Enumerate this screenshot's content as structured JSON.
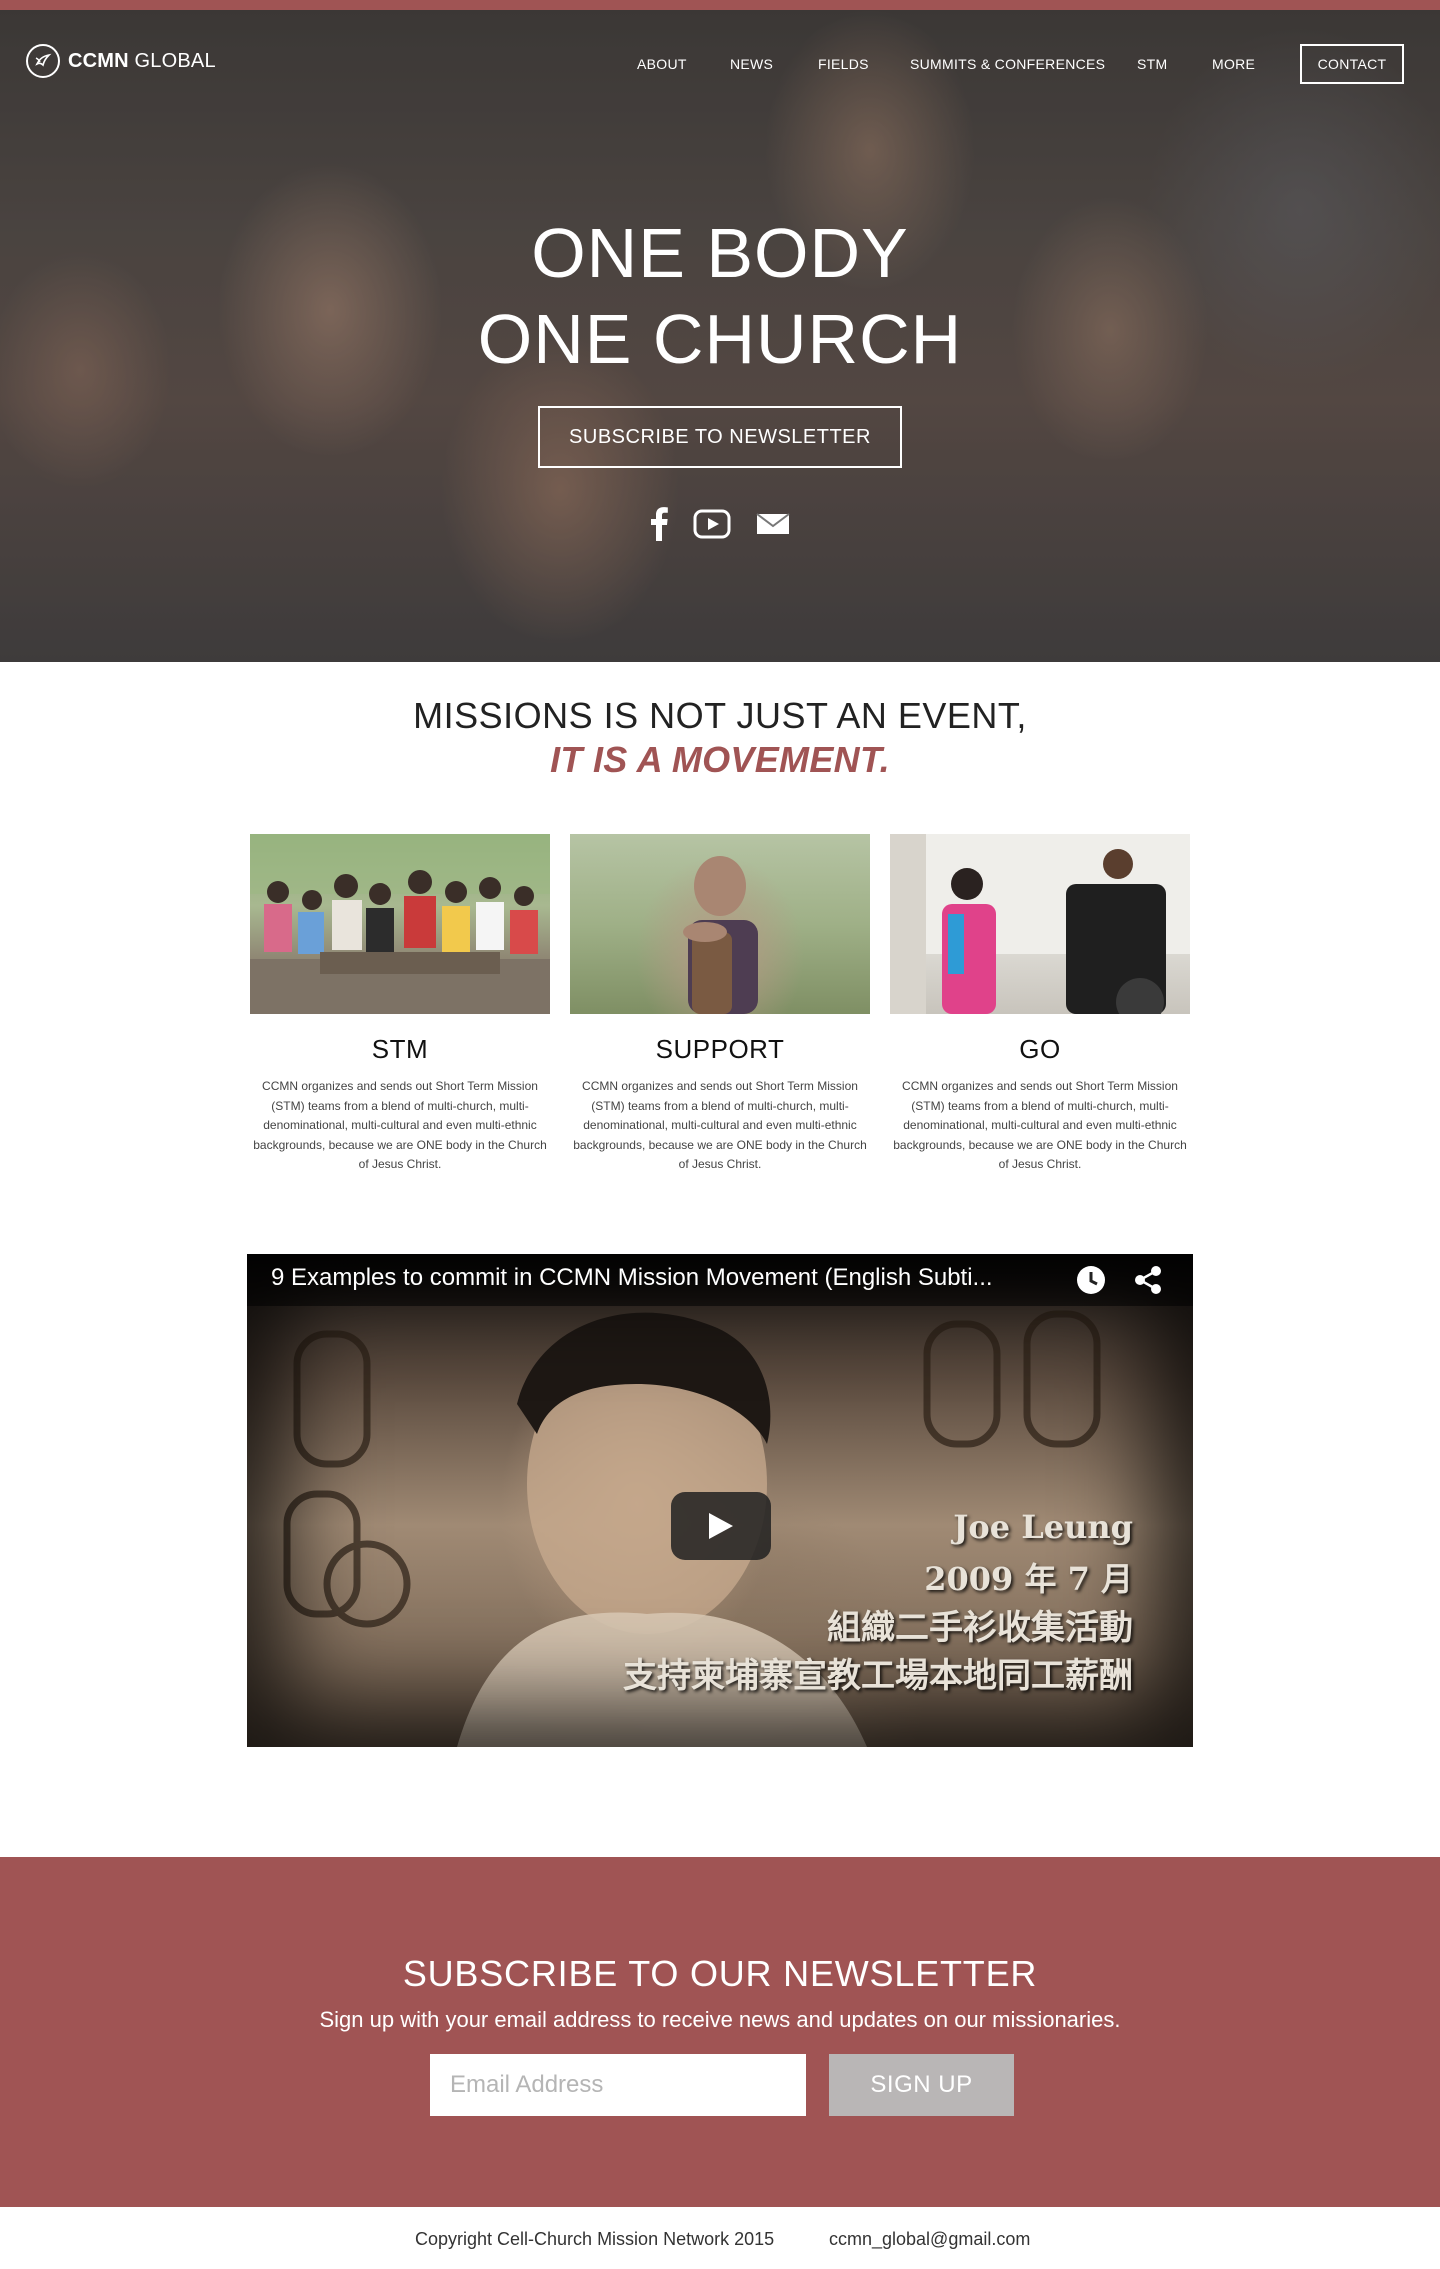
{
  "brand": {
    "logo_bold": "CCMN",
    "logo_light": " GLOBAL"
  },
  "nav": {
    "items": [
      {
        "label": "ABOUT"
      },
      {
        "label": "NEWS"
      },
      {
        "label": "FIELDS"
      },
      {
        "label": "SUMMITS & CONFERENCES"
      },
      {
        "label": "STM"
      },
      {
        "label": "MORE"
      }
    ],
    "contact_label": "CONTACT"
  },
  "hero": {
    "title_line1": "ONE BODY",
    "title_line2": "ONE CHURCH",
    "subscribe_label": "SUBSCRIBE TO NEWSLETTER",
    "social_icons": [
      "facebook-icon",
      "youtube-icon",
      "email-icon"
    ]
  },
  "missions": {
    "line1": "MISSIONS IS NOT JUST AN EVENT,",
    "line2": "IT IS A MOVEMENT.",
    "cards": [
      {
        "title": "STM",
        "text": "CCMN organizes and sends out Short Term Mission (STM) teams from a blend of multi-church, multi-denominational, multi-cultural and even multi-ethnic backgrounds, because we are ONE body in the Church of Jesus Christ."
      },
      {
        "title": "SUPPORT",
        "text": "CCMN organizes and sends out Short Term Mission (STM) teams from a blend of multi-church, multi-denominational, multi-cultural and even multi-ethnic backgrounds, because we are ONE body in the Church of Jesus Christ."
      },
      {
        "title": "GO",
        "text": "CCMN organizes and sends out Short Term Mission (STM) teams from a blend of multi-church, multi-denominational, multi-cultural and even multi-ethnic backgrounds, because we are ONE body in the Church of Jesus Christ."
      }
    ]
  },
  "video": {
    "title": "9 Examples to commit in CCMN Mission Movement (English Subti...",
    "caption_lines": [
      "Joe Leung",
      "2009 年 7 月",
      "組織二手衫收集活動",
      "支持柬埔寨宣教工場本地同工薪酬"
    ]
  },
  "newsletter": {
    "title": "SUBSCRIBE TO OUR NEWSLETTER",
    "subtitle": "Sign up with your email address to receive news and updates on our missionaries.",
    "email_placeholder": "Email Address",
    "signup_label": "SIGN UP"
  },
  "footer": {
    "copyright": "Copyright Cell-Church Mission Network 2015",
    "email": "ccmn_global@gmail.com"
  },
  "colors": {
    "accent": "#a05454",
    "button_gray": "#b9b6b6"
  }
}
